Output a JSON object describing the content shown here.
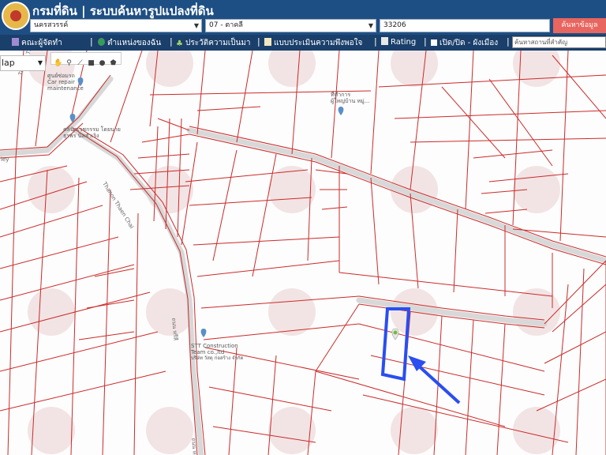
{
  "header": {
    "title": "กรมที่ดิน | ระบบค้นหารูปแปลงที่ดิน",
    "province": "นครสวรรค์",
    "district": "07 - ตาคลี",
    "parcel_no": "33206",
    "search_button": "ค้นหาข้อมูล"
  },
  "menu": {
    "items": [
      "คณะผู้จัดทำ",
      "ตำแหน่งของฉัน",
      "ประวัติความเป็นมา",
      "แบบประเมินความพึงพอใจ",
      "Rating",
      "เปิด/ปิด - ผังเมือง"
    ],
    "search_placeholder": "ค้นหาสถานที่สำคัญ"
  },
  "map": {
    "type_selector": "lap",
    "poi": [
      {
        "name": "ศูนย์ซ่อมรถ Car repair and maintenance",
        "lines": [
          "ศูนย์ซ่อมรถ",
          "Car repair",
          "maintenance"
        ]
      },
      {
        "name": "ที่ทำการผู้ใหญ่บ้าน หมู่...",
        "lines": [
          "ที่ทำการ",
          "ผู้ใหญ่บ้าน หมู่..."
        ]
      },
      {
        "name": "คลินิกแพทย์",
        "lines": [
          "คลินิกเวชกรรม โดยนาย",
          "ธุรพร นิลสำเริง"
        ]
      },
      {
        "name": "STT Construction Team co.,ltd",
        "lines": [
          "STT Construction",
          "Team co.,ltd",
          "บริษัท วัสดุ ก่อสร้าง จำกัด"
        ]
      }
    ],
    "roads": [
      "Thanon Thaen Chai",
      "Thanon Thaen Chai",
      "ถนน หรีสี",
      "ถนน หลี",
      "ley"
    ],
    "colors": {
      "parcel_lines": "#cc2a2a",
      "highlight": "#2a4ef0",
      "header": "#1e4f84",
      "menu": "#1a3f6b",
      "button": "#e8665f"
    }
  }
}
